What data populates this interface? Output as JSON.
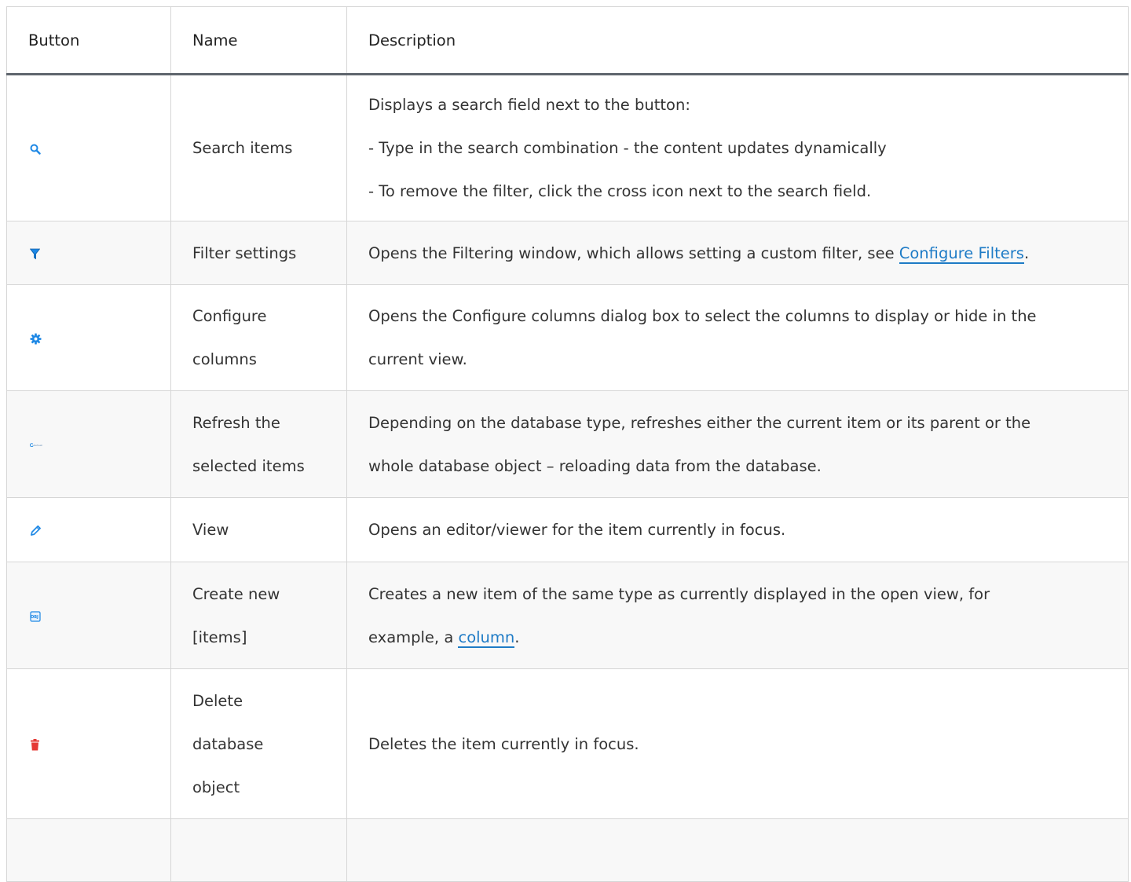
{
  "columns": {
    "button": "Button",
    "name": "Name",
    "description": "Description"
  },
  "rows": [
    {
      "icon": "search-icon",
      "name": [
        "Search items"
      ],
      "description": [
        "Displays a search field next to the button:",
        "- Type in the search combination - the content updates dynamically",
        "- To remove the filter, click the cross icon next to the search field."
      ]
    },
    {
      "icon": "filter-icon",
      "name": [
        "Filter settings"
      ],
      "description_pre": "Opens the Filtering window, which allows setting a custom filter, see ",
      "link": "Configure Filters",
      "description_post": "."
    },
    {
      "icon": "gear-icon",
      "name": [
        "Configure",
        "columns"
      ],
      "description": [
        "Opens the Configure columns dialog box to select the columns to display or hide in the",
        "current view."
      ]
    },
    {
      "icon": "refresh-icon",
      "icon_text": "Refresh",
      "name": [
        "Refresh the",
        "selected items"
      ],
      "description": [
        "Depending on the database type, refreshes either the current item or its parent or the",
        "whole database object – reloading data from the database."
      ]
    },
    {
      "icon": "pencil-icon",
      "name": [
        "View"
      ],
      "description": [
        "Opens an editor/viewer for the item currently in focus."
      ]
    },
    {
      "icon": "new-object-icon",
      "icon_text": "OBJ",
      "name": [
        "Create new",
        "[items]"
      ],
      "description_line1": "Creates a new item of the same type as currently displayed in the open view, for",
      "description_pre": "example, a ",
      "link": "column",
      "description_post": "."
    },
    {
      "icon": "trash-icon",
      "name": [
        "Delete",
        "database",
        "object"
      ],
      "description": [
        "Deletes the item currently in focus."
      ]
    }
  ],
  "colors": {
    "link": "#1e7bc6",
    "icon_blue": "#1e88e5",
    "icon_red": "#e53935",
    "header_rule": "#5f656d"
  }
}
